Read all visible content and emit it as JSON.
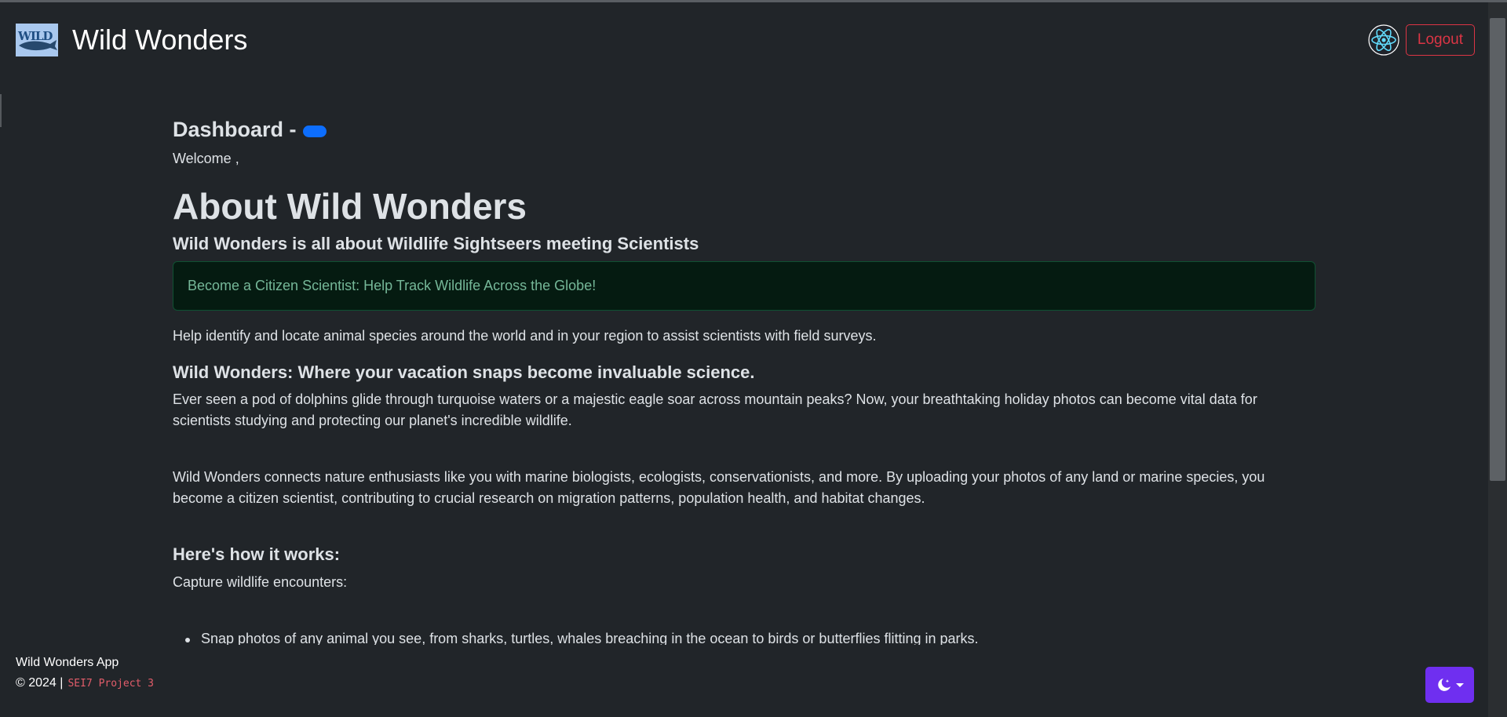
{
  "navbar": {
    "logo_text": "WILD",
    "title": "Wild Wonders",
    "logout_label": "Logout"
  },
  "dashboard": {
    "title": "Dashboard -",
    "welcome": "Welcome ,"
  },
  "content": {
    "about_heading": "About Wild Wonders",
    "tagline": "Wild Wonders is all about Wildlife Sightseers meeting Scientists",
    "alert_text": "Become a Citizen Scientist: Help Track Wildlife Across the Globe!",
    "intro": "Help identify and locate animal species around the world and in your region to assist scientists with field surveys.",
    "vacation_heading": "Wild Wonders: Where your vacation snaps become invaluable science.",
    "paragraph_1": "Ever seen a pod of dolphins glide through turquoise waters or a majestic eagle soar across mountain peaks? Now, your breathtaking holiday photos can become vital data for scientists studying and protecting our planet's incredible wildlife.",
    "paragraph_2": "Wild Wonders connects nature enthusiasts like you with marine biologists, ecologists, conservationists, and more. By uploading your photos of any land or marine species, you become a citizen scientist, contributing to crucial research on migration patterns, population health, and habitat changes.",
    "how_heading": "Here's how it works:",
    "capture": "Capture wildlife encounters:",
    "list_items": [
      "Snap photos of any animal you see, from sharks, turtles, whales breaching in the ocean to birds or butterflies flitting in parks."
    ]
  },
  "footer": {
    "app_name": "Wild Wonders App",
    "copyright": "© 2024 |",
    "project_code": "SEI7 Project 3"
  },
  "colors": {
    "background": "#212529",
    "danger": "#dc3545",
    "primary": "#0d6efd",
    "success_text": "#75b798",
    "theme_button": "#6f2ff0"
  },
  "icons": {
    "brand_logo": "wild-logo",
    "react": "react-atom-icon",
    "theme": "moon-stars-icon"
  }
}
